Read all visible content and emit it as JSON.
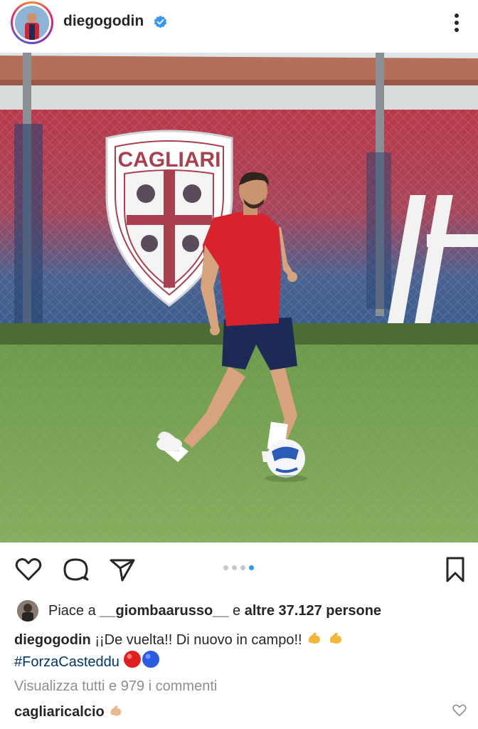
{
  "post": {
    "username": "diegogodin",
    "verified_icon": "verified-badge-icon",
    "more_icon": "more-options-icon"
  },
  "actions": {
    "like_icon": "heart-icon",
    "comment_icon": "comment-icon",
    "share_icon": "share-icon",
    "save_icon": "bookmark-icon",
    "carousel": {
      "total": 4,
      "active_index": 3
    }
  },
  "likes": {
    "prefix": "Piace a ",
    "liker": "__giombaarusso__",
    "connector": " e ",
    "others": "altre 37.127 persone"
  },
  "caption": {
    "username": "diegogodin",
    "text": " ¡¡De vuelta!! Di nuovo in campo!! ",
    "hashtag": "#ForzaCasteddu"
  },
  "comments": {
    "view_all": "Visualizza tutti e 979 i commenti",
    "first_username": "cagliaricalcio"
  },
  "photo": {
    "banner_text": "CAGLIARI",
    "colors": {
      "banner_red": "#b83a4a",
      "banner_blue": "#3a5c8c",
      "grass": "#7da35a",
      "shirt": "#d8232f",
      "shorts": "#1d2a55"
    }
  }
}
